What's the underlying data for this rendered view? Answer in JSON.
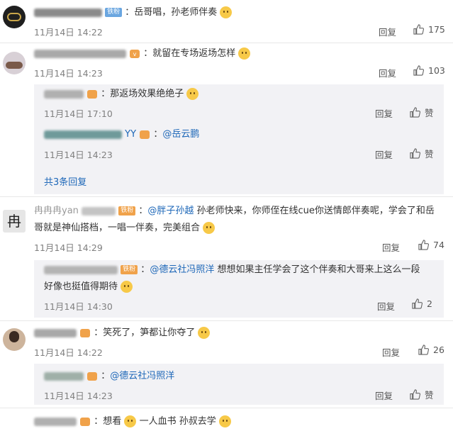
{
  "c1": {
    "text": "：岳哥唱，孙老师伴奏",
    "time": "11月14日 14:22",
    "reply": "回复",
    "likes": "175"
  },
  "c2": {
    "text": "：就留在专场返场怎样",
    "time": "11月14日 14:23",
    "reply": "回复",
    "likes": "103",
    "sub1": {
      "text": "：那返场效果绝绝子",
      "time": "11月14日 17:10",
      "reply": "回复",
      "like_label": "赞"
    },
    "sub2": {
      "name_tail": "YY",
      "colon": "：",
      "mention": "@岳云鹏",
      "time": "11月14日 14:23",
      "reply": "回复",
      "like_label": "赞"
    },
    "more": "共3条回复"
  },
  "c3": {
    "name": "冉冉冉yan",
    "colon": "：",
    "mention": "@胖子孙越",
    "text1": " 孙老师快来，你师侄在线cue你送情郎伴奏呢，学会了和岳",
    "text2": "哥就是神仙搭档，一唱一伴奏，完美组合",
    "time": "11月14日 14:29",
    "reply": "回复",
    "likes": "74",
    "sub1": {
      "colon": "：",
      "mention": "@德云社冯照洋",
      "text1": " 想想如果主任学会了这个伴奏和大哥来上这么一段",
      "text2": "好像也挺值得期待",
      "time": "11月14日 14:30",
      "reply": "回复",
      "likes": "2"
    }
  },
  "c4": {
    "text": "：笑死了，笋都让你夺了",
    "time": "11月14日 14:22",
    "reply": "回复",
    "likes": "26",
    "sub1": {
      "colon": "：",
      "mention": "@德云社冯照洋",
      "time": "11月14日 14:23",
      "reply": "回复",
      "like_label": "赞"
    }
  },
  "c5": {
    "text1": "：想看",
    "text2": " 一人血书  孙叔去学"
  },
  "badges": {
    "fan": "铁粉",
    "fan2": "铁粉"
  },
  "colors": {
    "link": "#1d67b8",
    "username": "#eb7350",
    "meta": "#808080",
    "sub_bg": "#f2f2f5"
  }
}
